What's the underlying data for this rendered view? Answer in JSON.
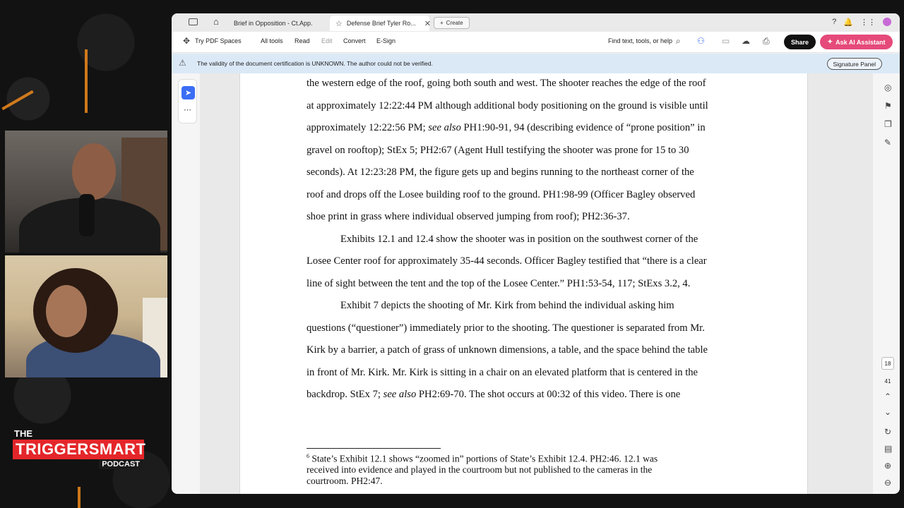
{
  "tabs": [
    {
      "label": "Brief in Opposition - Ct.App.",
      "icon": "document-icon"
    },
    {
      "label": "Defense Brief Tyler Ro...",
      "icon": "star-icon",
      "close": "✕"
    }
  ],
  "create_button": "Create",
  "toolbar": {
    "spaces": "Try PDF Spaces",
    "all_tools": "All tools",
    "read": "Read",
    "edit": "Edit",
    "convert": "Convert",
    "esign": "E-Sign",
    "search_label": "Find text, tools, or help",
    "share": "Share",
    "ai_assistant": "Ask AI Assistant"
  },
  "banner": {
    "message": "The validity of the document certification is UNKNOWN. The author could not be verified.",
    "signature_panel": "Signature Panel"
  },
  "document": {
    "lines": [
      {
        "text": "the western edge of the roof, going both south and west. The shooter reaches the edge of the roof",
        "indent": false
      },
      {
        "text": "at approximately 12:22:44 PM although additional body positioning on the ground is visible until",
        "indent": false
      },
      {
        "text": "approximately 12:22:56 PM; see also PH1:90-91, 94 (describing evidence of “prone position” in",
        "indent": false
      },
      {
        "text": "gravel on rooftop); StEx 5; PH2:67 (Agent Hull testifying the shooter was prone for 15 to 30",
        "indent": false
      },
      {
        "text": "seconds). At 12:23:28 PM, the figure gets up and begins running to the northeast corner of the",
        "indent": false
      },
      {
        "text": "roof and drops off the Losee building roof to the ground. PH1:98-99 (Officer Bagley observed",
        "indent": false
      },
      {
        "text": "shoe print in grass where individual observed jumping from roof); PH2:36-37.",
        "indent": false
      },
      {
        "text": "Exhibits 12.1 and 12.4 show the shooter was in position on the southwest corner of the",
        "indent": true
      },
      {
        "text": "Losee Center roof for approximately 35-44 seconds. Officer Bagley testified that “there is a clear",
        "indent": false
      },
      {
        "text": "line of sight between the tent and the top of the Losee Center.” PH1:53-54, 117; StExs 3.2, 4.",
        "indent": false
      },
      {
        "text": "Exhibit 7 depicts the shooting of Mr. Kirk from behind the individual asking him",
        "indent": true
      },
      {
        "text": "questions (“questioner”) immediately prior to the shooting. The questioner is separated from Mr.",
        "indent": false
      },
      {
        "text": "Kirk by a barrier, a patch of grass of unknown dimensions, a table, and the space behind the table",
        "indent": false
      },
      {
        "text": "in front of Mr. Kirk. Mr. Kirk is sitting in a chair on an elevated platform that is centered in the",
        "indent": false
      },
      {
        "text": "backdrop. StEx 7; see also PH2:69-70. The shot occurs at 00:32 of this video. There is one",
        "indent": false
      }
    ],
    "footnote": {
      "marker": "6",
      "lines": [
        "State’s Exhibit 12.1 shows “zoomed in” portions of State’s Exhibit 12.4. PH2:46. 12.1 was",
        "received into evidence and played in the courtroom but not published to the cameras in the",
        "courtroom. PH2:47."
      ]
    }
  },
  "page_indicator": {
    "current": "18",
    "total": "41"
  },
  "logo": {
    "the": "THE",
    "main": "TRIGGERSMART",
    "sub": "PODCAST"
  },
  "colors": {
    "accent_blue": "#3b6ef5",
    "ai_pink": "#e54a7a",
    "banner_blue": "#dbe9f7",
    "logo_red": "#e4262a"
  }
}
